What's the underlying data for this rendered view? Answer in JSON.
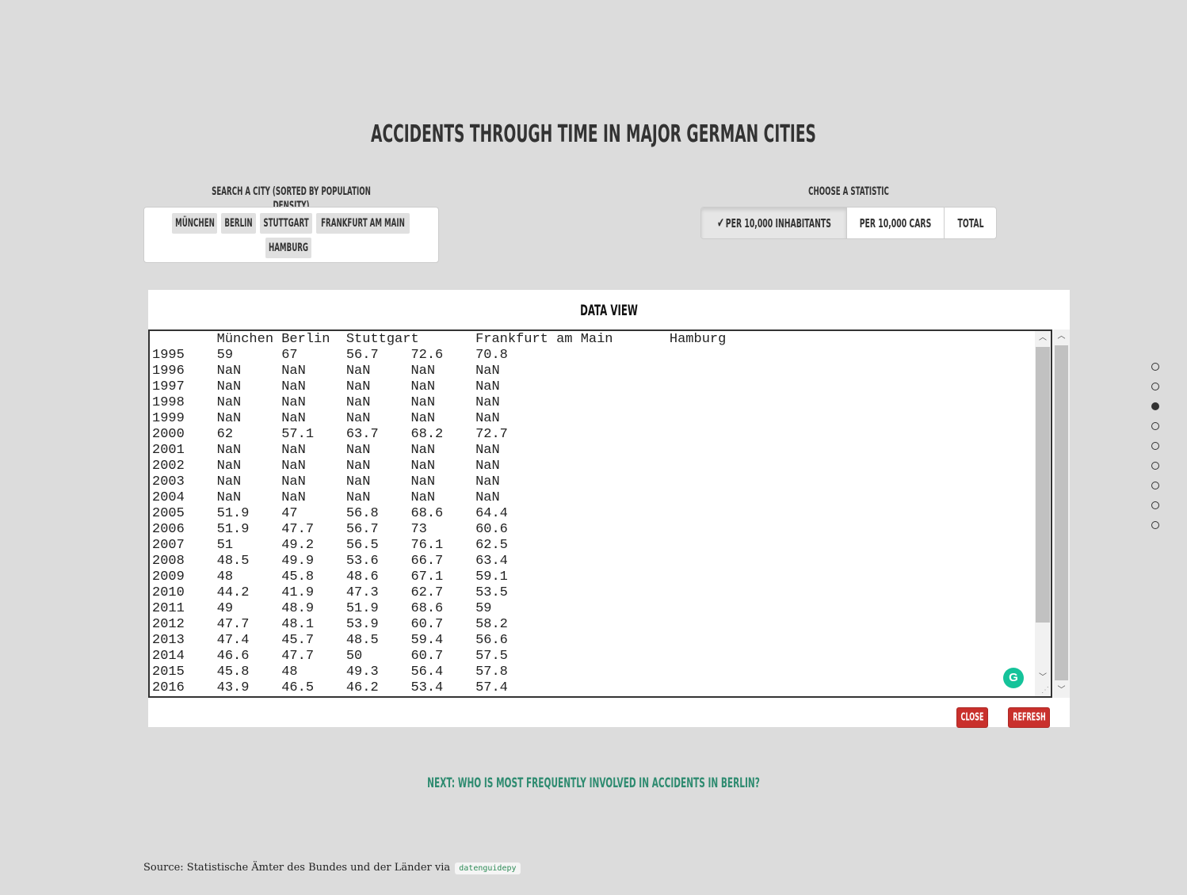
{
  "page": {
    "title": "Accidents through time in major German cities"
  },
  "city_search": {
    "label": "Search a city (sorted by population density)",
    "cities": [
      "München",
      "Berlin",
      "Stuttgart",
      "Frankfurt am Main",
      "Hamburg"
    ]
  },
  "statistic": {
    "label": "Choose a statistic",
    "options": [
      "Per 10,000 inhabitants",
      "Per 10,000 cars",
      "Total"
    ],
    "selected": "Per 10,000 inhabitants"
  },
  "data_view": {
    "title": "Data View",
    "columns": [
      "München",
      "Berlin",
      "Stuttgart",
      "Frankfurt am Main",
      "Hamburg"
    ],
    "rows": [
      [
        "1995",
        "59",
        "67",
        "56.7",
        "72.6",
        "70.8"
      ],
      [
        "1996",
        "NaN",
        "NaN",
        "NaN",
        "NaN",
        "NaN"
      ],
      [
        "1997",
        "NaN",
        "NaN",
        "NaN",
        "NaN",
        "NaN"
      ],
      [
        "1998",
        "NaN",
        "NaN",
        "NaN",
        "NaN",
        "NaN"
      ],
      [
        "1999",
        "NaN",
        "NaN",
        "NaN",
        "NaN",
        "NaN"
      ],
      [
        "2000",
        "62",
        "57.1",
        "63.7",
        "68.2",
        "72.7"
      ],
      [
        "2001",
        "NaN",
        "NaN",
        "NaN",
        "NaN",
        "NaN"
      ],
      [
        "2002",
        "NaN",
        "NaN",
        "NaN",
        "NaN",
        "NaN"
      ],
      [
        "2003",
        "NaN",
        "NaN",
        "NaN",
        "NaN",
        "NaN"
      ],
      [
        "2004",
        "NaN",
        "NaN",
        "NaN",
        "NaN",
        "NaN"
      ],
      [
        "2005",
        "51.9",
        "47",
        "56.8",
        "68.6",
        "64.4"
      ],
      [
        "2006",
        "51.9",
        "47.7",
        "56.7",
        "73",
        "60.6"
      ],
      [
        "2007",
        "51",
        "49.2",
        "56.5",
        "76.1",
        "62.5"
      ],
      [
        "2008",
        "48.5",
        "49.9",
        "53.6",
        "66.7",
        "63.4"
      ],
      [
        "2009",
        "48",
        "45.8",
        "48.6",
        "67.1",
        "59.1"
      ],
      [
        "2010",
        "44.2",
        "41.9",
        "47.3",
        "62.7",
        "53.5"
      ],
      [
        "2011",
        "49",
        "48.9",
        "51.9",
        "68.6",
        "59"
      ],
      [
        "2012",
        "47.7",
        "48.1",
        "53.9",
        "60.7",
        "58.2"
      ],
      [
        "2013",
        "47.4",
        "45.7",
        "48.5",
        "59.4",
        "56.6"
      ],
      [
        "2014",
        "46.6",
        "47.7",
        "50",
        "60.7",
        "57.5"
      ],
      [
        "2015",
        "45.8",
        "48",
        "49.3",
        "56.4",
        "57.8"
      ],
      [
        "2016",
        "43.9",
        "46.5",
        "46.2",
        "53.4",
        "57.4"
      ]
    ],
    "close_label": "Close",
    "refresh_label": "Refresh"
  },
  "next_link": "Next: Who is most frequently involved in accidents in Berlin?",
  "source": {
    "text": "Source: Statistische Ämter des Bundes und der Länder via",
    "code": "datenguidepy"
  },
  "nav": {
    "dot_count": 9,
    "active_index": 2
  },
  "colors": {
    "background": "#dcdcdc",
    "accent_green": "#2e8b70",
    "button_red": "#c9302c",
    "grammarly": "#15c39a"
  }
}
